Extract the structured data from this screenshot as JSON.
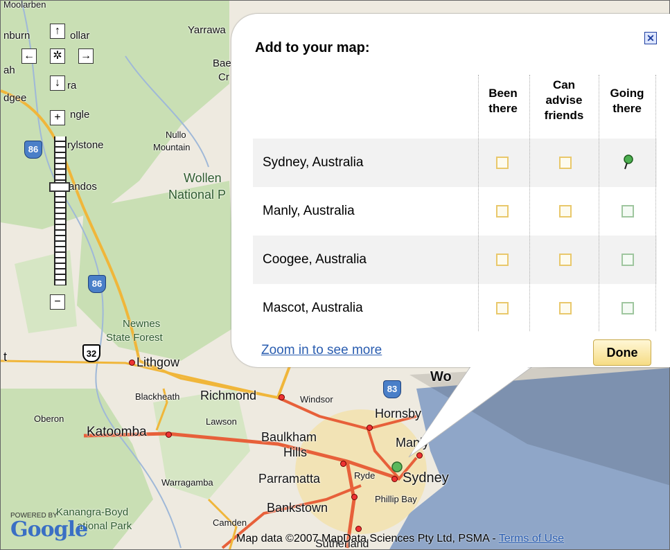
{
  "map": {
    "place_labels": [
      "Moolarben",
      "nburn",
      "ollar",
      "Yarrawa",
      "Bae",
      "Cr",
      "ah",
      "ra",
      "dgee",
      "ngle",
      "Nullo",
      "Mountain",
      "rylstone",
      "andos",
      "Wollen",
      "National P",
      "Newnes",
      "State Forest",
      "t",
      "Lithgow",
      "Blackheath",
      "Richmond",
      "Windsor",
      "Oberon",
      "Lawson",
      "Katoomba",
      "Hornsby",
      "Baulkham",
      "Hills",
      "Manly",
      "Parramatta",
      "Ryde",
      "Sydney",
      "Warragamba",
      "Phillip Bay",
      "Bankstown",
      "Kanangra-Boyd",
      "ational Park",
      "Camden",
      "Sutherland",
      "Wo"
    ],
    "road_shields": [
      "86",
      "86",
      "32",
      "83"
    ],
    "controls": {
      "pan_up": "↑",
      "pan_left": "←",
      "pan_center": "✲",
      "pan_right": "→",
      "pan_down": "↓",
      "zoom_in": "+",
      "zoom_out": "−"
    },
    "logo_small": "POWERED BY",
    "logo_text": "Google",
    "copyright": "Map data ©2007 MapData Sciences Pty Ltd, PSMA - ",
    "terms_link": "Terms of Use"
  },
  "popup": {
    "title": "Add to your map:",
    "close_label": "✕",
    "columns": [
      "Been\nthere",
      "Can\nadvise\nfriends",
      "Going\nthere"
    ],
    "rows": [
      {
        "label": "Sydney, Australia",
        "been": false,
        "advise": false,
        "going": "pin"
      },
      {
        "label": "Manly, Australia",
        "been": false,
        "advise": false,
        "going": false
      },
      {
        "label": "Coogee, Australia",
        "been": false,
        "advise": false,
        "going": false
      },
      {
        "label": "Mascot, Australia",
        "been": false,
        "advise": false,
        "going": false
      }
    ],
    "zoom_link": "Zoom in to see more",
    "done_label": "Done"
  },
  "colors": {
    "been": "#e9c86b",
    "going": "#9fc69f",
    "link": "#2a5db0",
    "water": "#8fa6c8",
    "land": "#eeeae0",
    "forest": "#c9dfb4"
  }
}
